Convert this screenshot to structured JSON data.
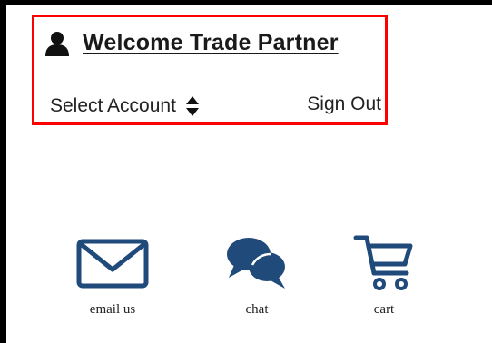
{
  "header": {
    "welcome_text": "Welcome Trade Partner",
    "select_account_label": "Select Account",
    "sign_out_label": "Sign Out"
  },
  "tools": {
    "email_label": "email us",
    "chat_label": "chat",
    "cart_label": "cart"
  },
  "colors": {
    "highlight_border": "#ff0000",
    "icon_blue": "#1f4a7a",
    "text": "#222222"
  },
  "icons": {
    "user": "user-icon",
    "sort": "sort-icon",
    "email": "envelope-icon",
    "chat": "chat-bubbles-icon",
    "cart": "shopping-cart-icon"
  }
}
